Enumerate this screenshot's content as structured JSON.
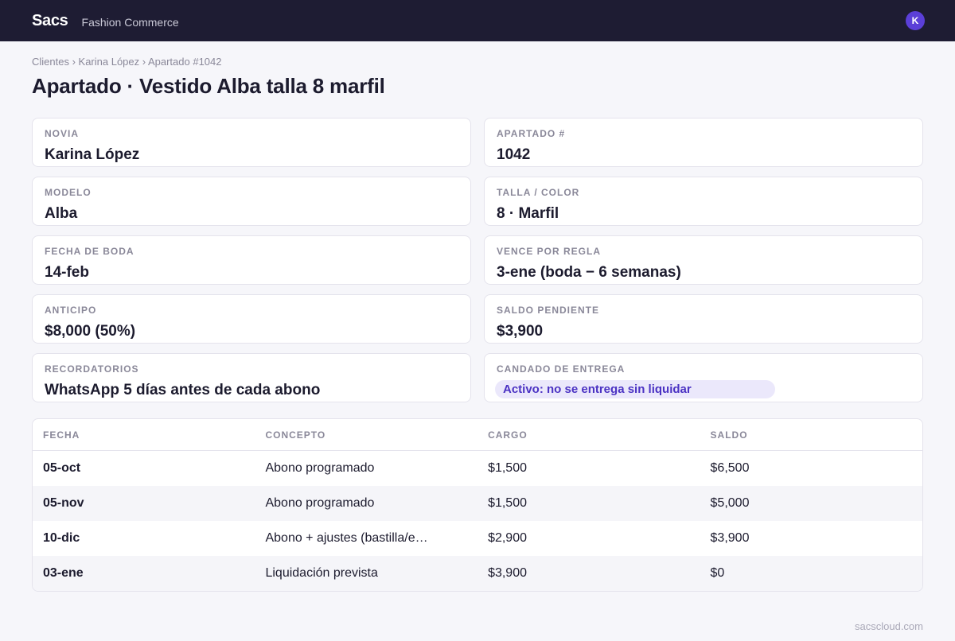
{
  "header": {
    "brand": "Sacs",
    "subtitle": "Fashion Commerce",
    "avatar_initial": "K"
  },
  "breadcrumb": "Clientes › Karina López › Apartado #1042",
  "title": "Apartado · Vestido Alba talla 8 marfil",
  "fields": {
    "novia": {
      "label": "NOVIA",
      "value": "Karina López"
    },
    "apartado": {
      "label": "APARTADO #",
      "value": "1042"
    },
    "modelo": {
      "label": "MODELO",
      "value": "Alba"
    },
    "talla": {
      "label": "TALLA / COLOR",
      "value": "8 · Marfil"
    },
    "fecha_boda": {
      "label": "FECHA DE BODA",
      "value": "14-feb"
    },
    "vence": {
      "label": "VENCE POR REGLA",
      "value": "3-ene (boda − 6 semanas)"
    },
    "anticipo": {
      "label": "ANTICIPO",
      "value": "$8,000 (50%)"
    },
    "saldo": {
      "label": "SALDO PENDIENTE",
      "value": "$3,900"
    },
    "recordatorios": {
      "label": "RECORDATORIOS",
      "value": "WhatsApp 5 días antes de cada abono"
    },
    "candado": {
      "label": "CANDADO DE ENTREGA",
      "value": "Activo: no se entrega sin liquidar"
    }
  },
  "table": {
    "columns": [
      "FECHA",
      "CONCEPTO",
      "CARGO",
      "SALDO"
    ],
    "rows": [
      {
        "fecha": "05-oct",
        "concepto": "Abono programado",
        "cargo": "$1,500",
        "saldo": "$6,500"
      },
      {
        "fecha": "05-nov",
        "concepto": "Abono programado",
        "cargo": "$1,500",
        "saldo": "$5,000"
      },
      {
        "fecha": "10-dic",
        "concepto": "Abono + ajustes (bastilla/entalle)",
        "cargo": "$2,900",
        "saldo": "$3,900"
      },
      {
        "fecha": "03-ene",
        "concepto": "Liquidación prevista",
        "cargo": "$3,900",
        "saldo": "$0"
      }
    ]
  },
  "footer": "sacscloud.com",
  "colors": {
    "topbar": "#1e1c33",
    "accent": "#5b3fd8",
    "badge_bg": "#ebe8fb",
    "badge_text": "#4b32c3"
  }
}
